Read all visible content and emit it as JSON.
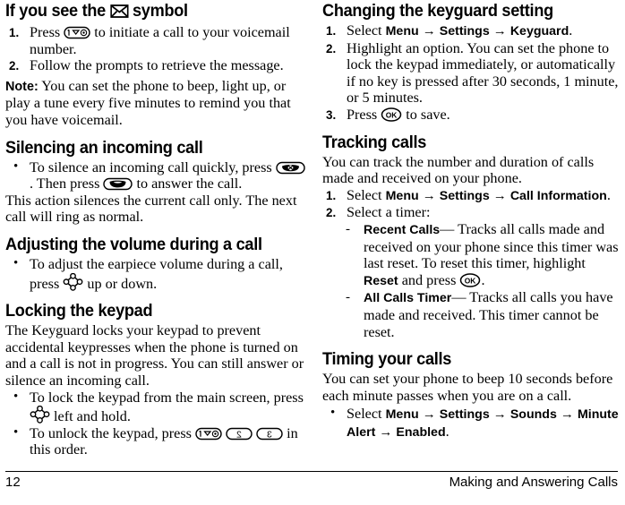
{
  "page": {
    "number": "12",
    "running_title": "Making and Answering Calls"
  },
  "left_column": {
    "heading_1": "If you see the   symbol",
    "heading_1_pre": "If you see the",
    "heading_1_post": "symbol",
    "steps_1": [
      {
        "num": "1.",
        "pre": "Press",
        "post": "to initiate a call to your voicemail number.",
        "icon": "voicemail-key-icon"
      },
      {
        "num": "2.",
        "pre": "",
        "post": "Follow the prompts to retrieve the message.",
        "icon": ""
      }
    ],
    "note_label": "Note:",
    "note_text": "You can set the phone to beep, light up, or play a tune every five minutes to remind you that you have voicemail.",
    "heading_2": "Silencing an incoming call",
    "bullet_2_pre": "To silence an incoming call quickly, press",
    "bullet_2_mid": ". Then press",
    "bullet_2_post": "to answer the call.",
    "para_2": "This action silences the current call only. The next call will ring as normal.",
    "heading_3": "Adjusting the volume during a call",
    "bullet_3_pre": "To adjust the earpiece volume during a call, press",
    "bullet_3_post": "up or down.",
    "heading_4": "Locking the keypad",
    "para_4": "The Keyguard locks your keypad to prevent accidental keypresses when the phone is turned on and a call is not in progress. You can still answer or silence an incoming call.",
    "bullet_4a_pre": "To lock the keypad from the main screen, press",
    "bullet_4a_post": "left and hold.",
    "bullet_4b_pre": "To unlock the keypad, press",
    "bullet_4b_post": "in this order."
  },
  "right_column": {
    "heading_1": "Changing the keyguard setting",
    "steps_1": [
      {
        "num": "1.",
        "lead": "Select",
        "path": [
          "Menu",
          "Settings",
          "Keyguard"
        ],
        "trail": "."
      },
      {
        "num": "2.",
        "text": "Highlight an option. You can set the phone to lock the keypad immediately, or automatically if no key is pressed after 30 seconds, 1 minute, or 5 minutes."
      },
      {
        "num": "3.",
        "pre": "Press",
        "post": "to save.",
        "icon": "ok-key-icon"
      }
    ],
    "heading_2": "Tracking calls",
    "para_2": "You can track the number and duration of calls made and received on your phone.",
    "steps_2": [
      {
        "num": "1.",
        "lead": "Select",
        "path": [
          "Menu",
          "Settings",
          "Call Information"
        ],
        "trail": "."
      },
      {
        "num": "2.",
        "text": "Select a timer:"
      }
    ],
    "timers": [
      {
        "term": "Recent Calls",
        "dash": "—",
        "text_1": "Tracks all calls made and received on your phone since this timer was last reset. To reset this timer, highlight",
        "bold_1": "Reset",
        "text_2": "and press",
        "text_3": ".",
        "icon": "ok-key-icon"
      },
      {
        "term": "All Calls Timer",
        "dash": "—",
        "text_1": "Tracks all calls you have made and received. This timer cannot be reset."
      }
    ],
    "heading_3": "Timing your calls",
    "para_3": "You can set your phone to beep 10 seconds before each minute passes when you are on a call.",
    "bullet_3_lead": "Select",
    "bullet_3_path": [
      "Menu",
      "Settings",
      "Sounds",
      "Minute Alert",
      "Enabled"
    ],
    "bullet_3_trail": "."
  },
  "symbols": {
    "arrow": "→",
    "bullet": "•",
    "dash": "-",
    "envelope": "envelope-icon"
  },
  "keys": {
    "voicemail": {
      "name": "voicemail-key-icon",
      "digit": "1"
    },
    "two": {
      "name": "key-2-icon",
      "digit": "2"
    },
    "three": {
      "name": "key-3-icon",
      "digit": "3"
    },
    "ok": {
      "name": "ok-key-icon",
      "label": "OK"
    },
    "end": {
      "name": "end-call-key-icon"
    },
    "send": {
      "name": "send-call-key-icon"
    },
    "nav": {
      "name": "navigation-key-icon"
    }
  },
  "colors": {
    "text": "#000000",
    "background": "#ffffff",
    "rule": "#000000"
  }
}
